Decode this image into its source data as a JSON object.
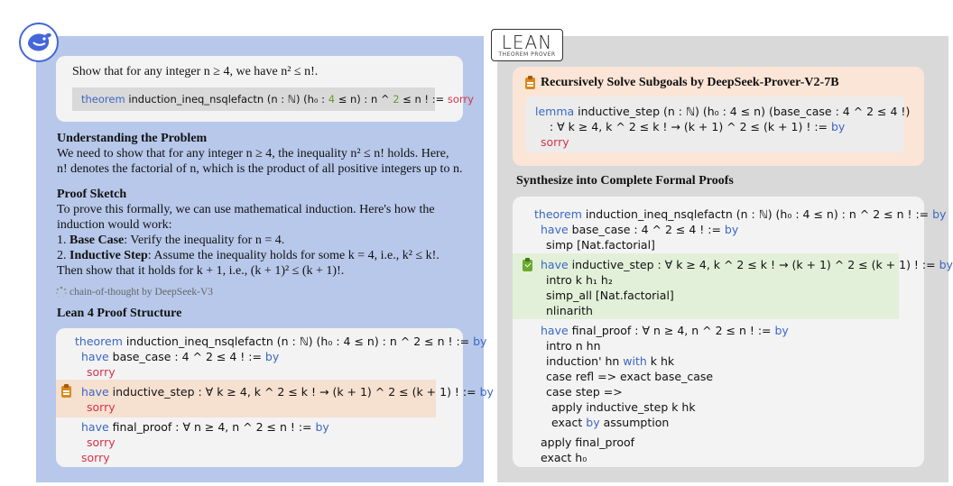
{
  "logos": {
    "lean_big": "LEAN",
    "lean_small": "THEOREM PROVER"
  },
  "left": {
    "problem": "Show that for any integer n ≥ 4, we have n² ≤ n!.",
    "problem_theorem": {
      "kw": "theorem",
      "text": " induction_ineq_nsqlefactn (n : ℕ) (h₀ : ",
      "num": "4",
      "text2": " ≤ n) : n ^ ",
      "num2": "2",
      "text3": " ≤ n ! := ",
      "sorry": "sorry"
    },
    "understanding_heading": "Understanding the Problem",
    "understanding_l1": "We need to show that for any integer n ≥ 4, the inequality n² ≤ n! holds. Here,",
    "understanding_l2": "n! denotes the factorial of n, which is the product of all positive integers up to n.",
    "sketch_heading": "Proof Sketch",
    "sketch_l1": "To prove this formally, we can use mathematical induction. Here's how the",
    "sketch_l2": "induction would work:",
    "sketch_l3_bold": "Base Case",
    "sketch_l3": ": Verify the inequality for n = 4.",
    "sketch_l4_bold": "Inductive Step",
    "sketch_l4": ": Assume the inequality holds for some k = 4, i.e., k² ≤ k!.",
    "sketch_l5": "Then show that it holds for k + 1, i.e., (k + 1)² ≤ (k + 1)!.",
    "sketch_num1": "1. ",
    "sketch_num2": "2. ",
    "cot_label": "chain-of-thought by DeepSeek-V3",
    "lean_heading": "Lean 4 Proof Structure",
    "lean": {
      "l1_kw": "theorem",
      "l1": " induction_ineq_nsqlefactn (n : ℕ) (h₀ : 4 ≤ n) : n ^ 2 ≤ n ! := ",
      "l1_by": "by",
      "l2_kw": "have",
      "l2": " base_case : 4 ^ 2 ≤ 4 ! := ",
      "l2_by": "by",
      "l3_sorry": "sorry",
      "l4_kw": "have",
      "l4": " inductive_step : ∀ k ≥ 4, k ^ 2 ≤ k ! → (k + 1) ^ 2 ≤ (k + 1) ! := ",
      "l4_by": "by",
      "l5_sorry": "sorry",
      "l6_kw": "have",
      "l6": " final_proof : ∀ n ≥ 4, n ^ 2 ≤ n ! := ",
      "l6_by": "by",
      "l7_sorry": "sorry",
      "l8_sorry": "sorry"
    }
  },
  "right": {
    "subgoal_heading": "Recursively Solve Subgoals by DeepSeek-Prover-V2-7B",
    "subgoal": {
      "l1_kw": "lemma",
      "l1": " inductive_step (n : ℕ) (h₀ : 4 ≤ n) (base_case : 4 ^ 2 ≤ 4 !)",
      "l2": "    : ∀ k ≥ 4, k ^ 2 ≤ k ! → (k + 1) ^ 2 ≤ (k + 1) ! := ",
      "l2_by": "by",
      "l3_sorry": "sorry"
    },
    "synth_heading": "Synthesize into Complete Formal Proofs",
    "complete": {
      "l1_kw": "theorem",
      "l1": " induction_ineq_nsqlefactn (n : ℕ) (h₀ : 4 ≤ n) : n ^ 2 ≤ n ! := ",
      "l1_by": "by",
      "l2_kw": "have",
      "l2": " base_case : 4 ^ 2 ≤ 4 ! := ",
      "l2_by": "by",
      "l3": "simp [Nat.factorial]",
      "l4_kw": "have",
      "l4": " inductive_step : ∀ k ≥ 4, k ^ 2 ≤ k ! → (k + 1) ^ 2 ≤ (k + 1) ! := ",
      "l4_by": "by",
      "l5": "intro k h₁ h₂",
      "l6": "simp_all [Nat.factorial]",
      "l7": "nlinarith",
      "l8_kw": "have",
      "l8": " final_proof : ∀ n ≥ 4, n ^ 2 ≤ n ! := ",
      "l8_by": "by",
      "l9": "intro n hn",
      "l10": "induction' hn ",
      "l10_kw": "with",
      "l10b": " k hk",
      "l11": "case refl => exact base_case",
      "l12": "case step =>",
      "l13": "apply inductive_step k hk",
      "l14": "exact ",
      "l14_kw": "by",
      "l14b": " assumption",
      "l15": "apply final_proof",
      "l16": "exact h₀"
    }
  }
}
